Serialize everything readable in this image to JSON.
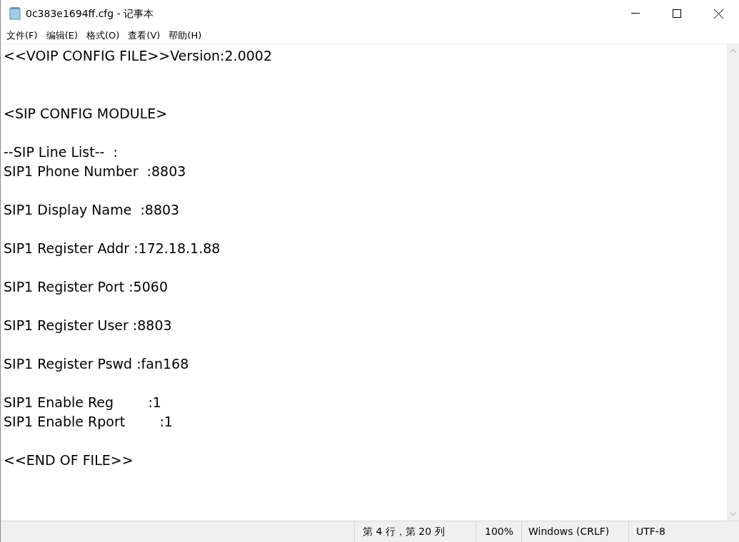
{
  "window": {
    "title": "0c383e1694ff.cfg - 记事本"
  },
  "menu": [
    "文件(F)",
    "编辑(E)",
    "格式(O)",
    "查看(V)",
    "帮助(H)"
  ],
  "editor": {
    "text": "<<VOIP CONFIG FILE>>Version:2.0002\n\n\n<SIP CONFIG MODULE>\n\n--SIP Line List--  :\nSIP1 Phone Number  :8803\n\nSIP1 Display Name  :8803\n\nSIP1 Register Addr :172.18.1.88\n\nSIP1 Register Port :5060\n\nSIP1 Register User :8803\n\nSIP1 Register Pswd :fan168\n\nSIP1 Enable Reg        :1\nSIP1 Enable Rport        :1\n\n<<END OF FILE>>"
  },
  "status_bar": {
    "position": "第 4 行，第 20 列",
    "zoom": "100%",
    "line_ending": "Windows (CRLF)",
    "encoding": "UTF-8"
  }
}
